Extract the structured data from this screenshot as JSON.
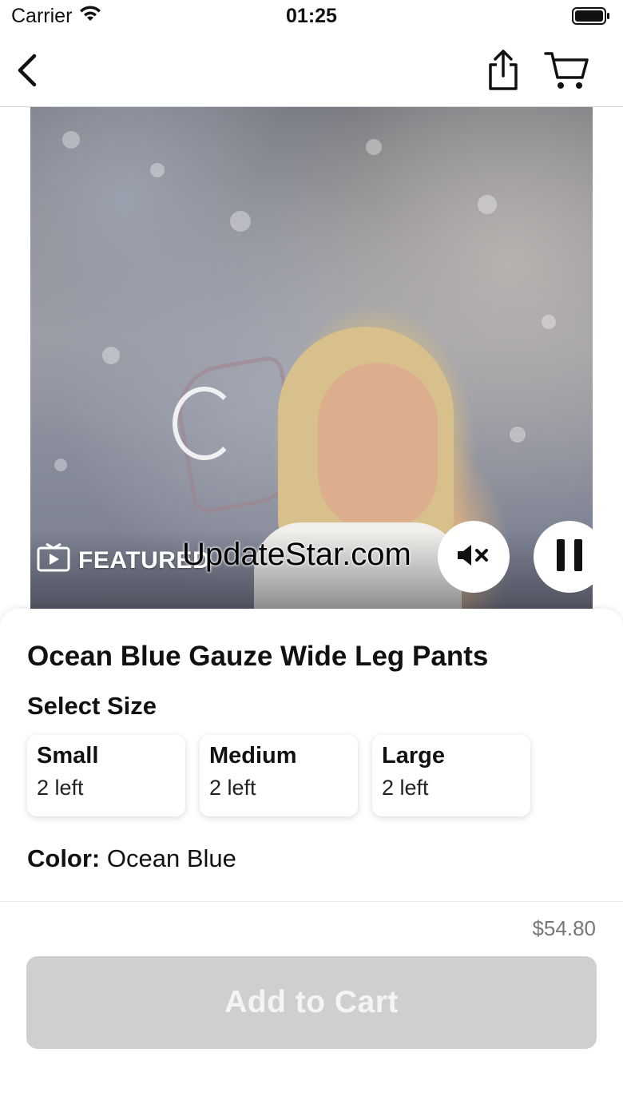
{
  "status_bar": {
    "carrier": "Carrier",
    "time": "01:25",
    "icons": [
      "wifi-icon",
      "battery-icon"
    ]
  },
  "nav": {
    "icons": [
      "back-chevron-icon",
      "share-icon",
      "cart-icon"
    ]
  },
  "video": {
    "featured_label": "FEATURED",
    "watermark": "UpdateStar.com",
    "icons": [
      "video-play-icon",
      "mute-icon",
      "pause-icon"
    ]
  },
  "product": {
    "title": "Ocean Blue Gauze Wide Leg Pants",
    "size_heading": "Select Size",
    "sizes": [
      {
        "name": "Small",
        "stock": "2 left"
      },
      {
        "name": "Medium",
        "stock": "2 left"
      },
      {
        "name": "Large",
        "stock": "2 left"
      }
    ],
    "color_label": "Color:",
    "color_value": "Ocean Blue"
  },
  "footer": {
    "price": "$54.80",
    "add_to_cart": "Add to Cart"
  },
  "colors": {
    "disabled_button": "#cfcfcf",
    "text": "#111111",
    "price": "#777777"
  }
}
